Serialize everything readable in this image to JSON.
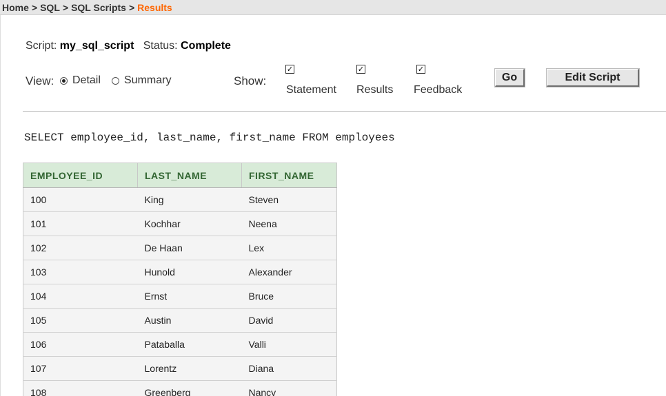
{
  "breadcrumb": {
    "items": [
      "Home",
      "SQL",
      "SQL Scripts"
    ],
    "separator": ">",
    "current": "Results"
  },
  "script_info": {
    "script_label": "Script:",
    "script_name": "my_sql_script",
    "status_label": "Status:",
    "status_value": "Complete"
  },
  "view": {
    "label": "View:",
    "options": [
      {
        "label": "Detail",
        "selected": true
      },
      {
        "label": "Summary",
        "selected": false
      }
    ]
  },
  "show": {
    "label": "Show:",
    "options": [
      {
        "label": "Statement",
        "checked": true
      },
      {
        "label": "Results",
        "checked": true
      },
      {
        "label": "Feedback",
        "checked": true
      }
    ]
  },
  "buttons": {
    "go": "Go",
    "edit_script": "Edit Script"
  },
  "statement": "SELECT employee_id, last_name, first_name FROM employees",
  "results": {
    "columns": [
      "EMPLOYEE_ID",
      "LAST_NAME",
      "FIRST_NAME"
    ],
    "rows": [
      [
        "100",
        "King",
        "Steven"
      ],
      [
        "101",
        "Kochhar",
        "Neena"
      ],
      [
        "102",
        "De Haan",
        "Lex"
      ],
      [
        "103",
        "Hunold",
        "Alexander"
      ],
      [
        "104",
        "Ernst",
        "Bruce"
      ],
      [
        "105",
        "Austin",
        "David"
      ],
      [
        "106",
        "Pataballa",
        "Valli"
      ],
      [
        "107",
        "Lorentz",
        "Diana"
      ],
      [
        "108",
        "Greenberg",
        "Nancy"
      ]
    ]
  },
  "colors": {
    "current_crumb": "#ff6600",
    "header_bg": "#d8ebd8",
    "header_text": "#336633",
    "row_bg": "#f4f4f4"
  }
}
